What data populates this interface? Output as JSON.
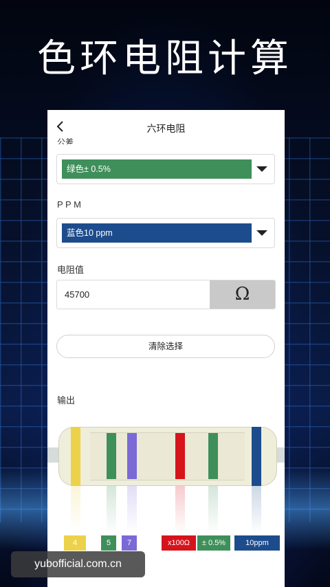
{
  "headline": "色环电阻计算",
  "nav": {
    "title": "六环电阻",
    "back_icon": "chevron-left-icon"
  },
  "tolerance": {
    "label": "公差",
    "selected": "绿色± 0.5%",
    "color": "#3f8f5a"
  },
  "ppm": {
    "label": "P P M",
    "selected": "蓝色10 ppm",
    "color": "#1d4c8c"
  },
  "resistance": {
    "label": "电阻值",
    "value": "45700",
    "unit_button": "Ω"
  },
  "clear_button": "清除选择",
  "output": {
    "label": "输出",
    "bands": [
      {
        "label": "4",
        "color": "#ecd24a"
      },
      {
        "label": "5",
        "color": "#3f8f5a"
      },
      {
        "label": "7",
        "color": "#7a6ad6"
      },
      {
        "label": "x100Ω",
        "color": "#d5141c"
      },
      {
        "label": "± 0.5%",
        "color": "#3f8f5a"
      },
      {
        "label": "10ppm",
        "color": "#1d4c8c"
      }
    ]
  },
  "watermark": "yubofficial.com.cn"
}
